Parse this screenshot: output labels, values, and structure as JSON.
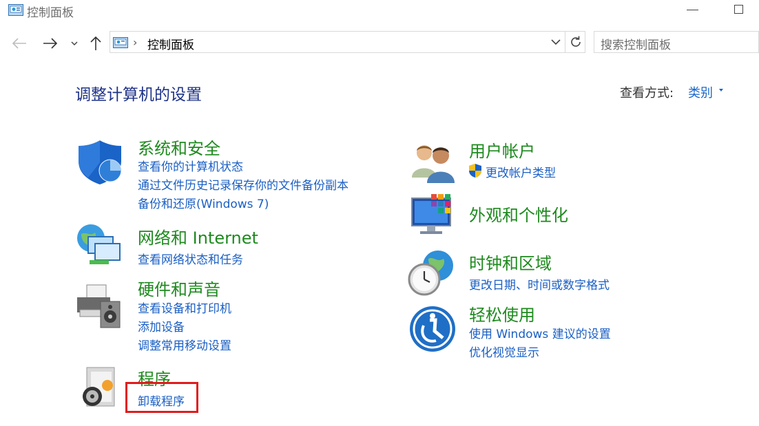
{
  "window": {
    "title": "控制面板"
  },
  "address": {
    "path_item": "控制面板"
  },
  "search": {
    "placeholder": "搜索控制面板"
  },
  "heading": {
    "title": "调整计算机的设置",
    "view_by_label": "查看方式:",
    "view_by_value": "类别"
  },
  "categories": {
    "system_security": {
      "title": "系统和安全",
      "links": [
        "查看你的计算机状态",
        "通过文件历史记录保存你的文件备份副本",
        "备份和还原(Windows 7)"
      ]
    },
    "network": {
      "title": "网络和 Internet",
      "links": [
        "查看网络状态和任务"
      ]
    },
    "hardware": {
      "title": "硬件和声音",
      "links": [
        "查看设备和打印机",
        "添加设备",
        "调整常用移动设置"
      ]
    },
    "programs": {
      "title": "程序",
      "links": [
        "卸载程序"
      ]
    },
    "user_accounts": {
      "title": "用户帐户",
      "links": [
        "更改帐户类型"
      ]
    },
    "appearance": {
      "title": "外观和个性化"
    },
    "clock_region": {
      "title": "时钟和区域",
      "links": [
        "更改日期、时间或数字格式"
      ]
    },
    "ease_of_access": {
      "title": "轻松使用",
      "links": [
        "使用 Windows 建议的设置",
        "优化视觉显示"
      ]
    }
  },
  "colors": {
    "category_title": "#1e8a1e",
    "link": "#1a5fc4",
    "heading": "#1e3287",
    "highlight": "#e21b1b"
  }
}
